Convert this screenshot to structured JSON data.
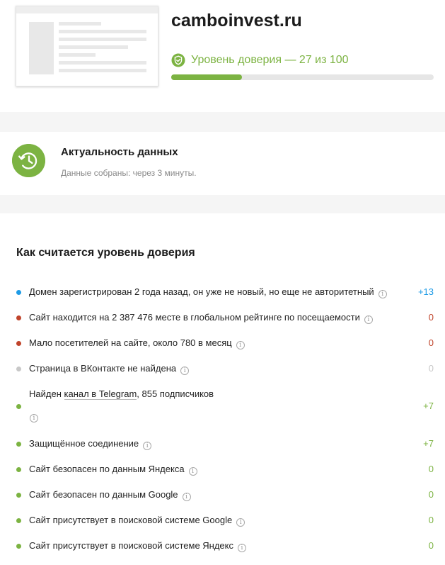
{
  "site": {
    "domain": "camboinvest.ru",
    "trust_label": "Уровень доверия — 27 из 100",
    "trust_score": 27,
    "trust_max": 100,
    "accent_color": "#7cb342",
    "shield_icon": "shield-check-icon"
  },
  "freshness": {
    "icon": "history-icon",
    "title": "Актуальность данных",
    "subtitle": "Данные собраны: через 3 минуты."
  },
  "rating": {
    "title": "Как считается уровень доверия",
    "items": [
      {
        "text": "Домен зарегистрирован 2 года назад, он уже не новый, но еще не авторитетный",
        "score": "+13",
        "dot": "#1e9be6",
        "score_color": "#1e9be6"
      },
      {
        "text": "Сайт находится на 2 387 476 месте в глобальном рейтинге по посещаемости",
        "score": "0",
        "dot": "#c0442b",
        "score_color": "#c0442b"
      },
      {
        "text": "Мало посетителей на сайте, около 780 в месяц",
        "score": "0",
        "dot": "#c0442b",
        "score_color": "#c0442b"
      },
      {
        "text": "Страница в ВКонтакте не найдена",
        "score": "0",
        "dot": "#c8c8c8",
        "score_color": "#c8c8c8"
      },
      {
        "text_before": "Найден ",
        "link": "канал в Telegram",
        "text_after": ", 855 подписчиков",
        "score": "+7",
        "dot": "#7cb342",
        "score_color": "#7cb342"
      },
      {
        "text": "Защищённое соединение",
        "score": "+7",
        "dot": "#7cb342",
        "score_color": "#7cb342"
      },
      {
        "text": "Сайт безопасен по данным Яндекса",
        "score": "0",
        "dot": "#7cb342",
        "score_color": "#7cb342"
      },
      {
        "text": "Сайт безопасен по данным Google",
        "score": "0",
        "dot": "#7cb342",
        "score_color": "#7cb342"
      },
      {
        "text": "Сайт присутствует в поисковой системе Google",
        "score": "0",
        "dot": "#7cb342",
        "score_color": "#7cb342"
      },
      {
        "text": "Сайт присутствует в поисковой системе Яндекс",
        "score": "0",
        "dot": "#7cb342",
        "score_color": "#7cb342"
      }
    ]
  }
}
